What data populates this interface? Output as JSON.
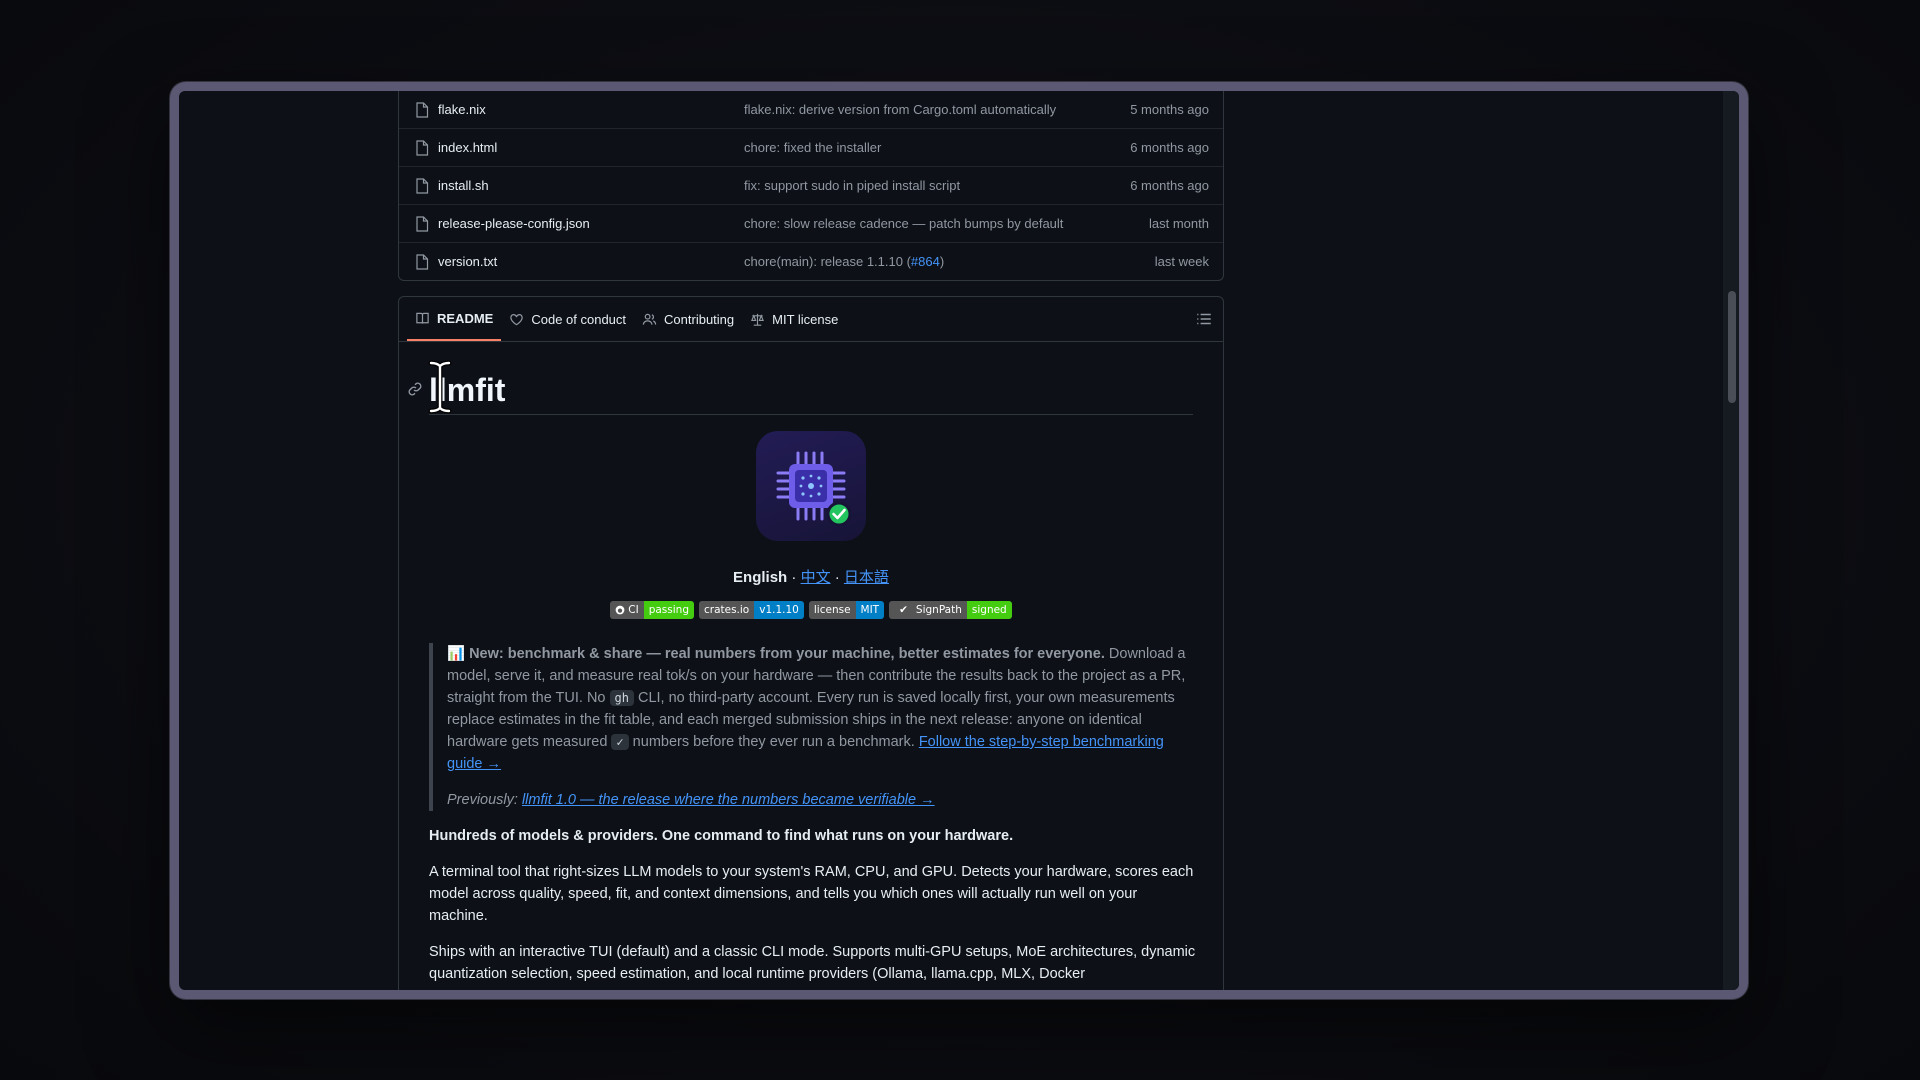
{
  "files": [
    {
      "name": "flake.nix",
      "message": "flake.nix: derive version from Cargo.toml automatically",
      "link": "",
      "time": "5 months ago"
    },
    {
      "name": "index.html",
      "message": "chore: fixed the installer",
      "link": "",
      "time": "6 months ago"
    },
    {
      "name": "install.sh",
      "message": "fix: support sudo in piped install script",
      "link": "",
      "time": "6 months ago"
    },
    {
      "name": "release-please-config.json",
      "message": "chore: slow release cadence — patch bumps by default",
      "link": "",
      "time": "last month"
    },
    {
      "name": "version.txt",
      "message": "chore(main): release 1.1.10 (",
      "link": "#864",
      "time": "last week"
    }
  ],
  "tabs": [
    "README",
    "Code of conduct",
    "Contributing",
    "MIT license"
  ],
  "readme": {
    "title": "llmfit",
    "lang_current": "English",
    "lang_sep": " · ",
    "lang_zh": "中文",
    "lang_ja": "日本語",
    "badges": [
      {
        "label": "CI",
        "value": "passing",
        "color": "#44cc11"
      },
      {
        "label": "crates.io",
        "value": "v1.1.10",
        "color": "#007ec6"
      },
      {
        "label": "license",
        "value": "MIT",
        "color": "#007ec6"
      },
      {
        "label": "SignPath",
        "value": "signed",
        "color": "#44cc11"
      }
    ],
    "quote_bold": "📊 New: benchmark & share — real numbers from your machine, better estimates for everyone.",
    "quote_text1": " Download a model, serve it, and measure real tok/s on your hardware — then contribute the results back to the project as a PR, straight from the TUI. No ",
    "quote_code1": "gh",
    "quote_text2": " CLI, no third-party account. Every run is saved locally first, your own measurements replace estimates in the fit table, and each merged submission ships in the next release: anyone on identical hardware gets measured ",
    "quote_code2": "✓",
    "quote_text3": " numbers before they ever run a benchmark. ",
    "quote_link": "Follow the step-by-step benchmarking guide →",
    "prev_label": "Previously: ",
    "prev_link": "llmfit 1.0 — the release where the numbers became verifiable →",
    "tagline": "Hundreds of models & providers. One command to find what runs on your hardware.",
    "para1": "A terminal tool that right-sizes LLM models to your system's RAM, CPU, and GPU. Detects your hardware, scores each model across quality, speed, fit, and context dimensions, and tells you which ones will actually run well on your machine.",
    "para2": "Ships with an interactive TUI (default) and a classic CLI mode. Supports multi-GPU setups, MoE architectures, dynamic quantization selection, speed estimation, and local runtime providers (Ollama, llama.cpp, MLX, Docker"
  }
}
